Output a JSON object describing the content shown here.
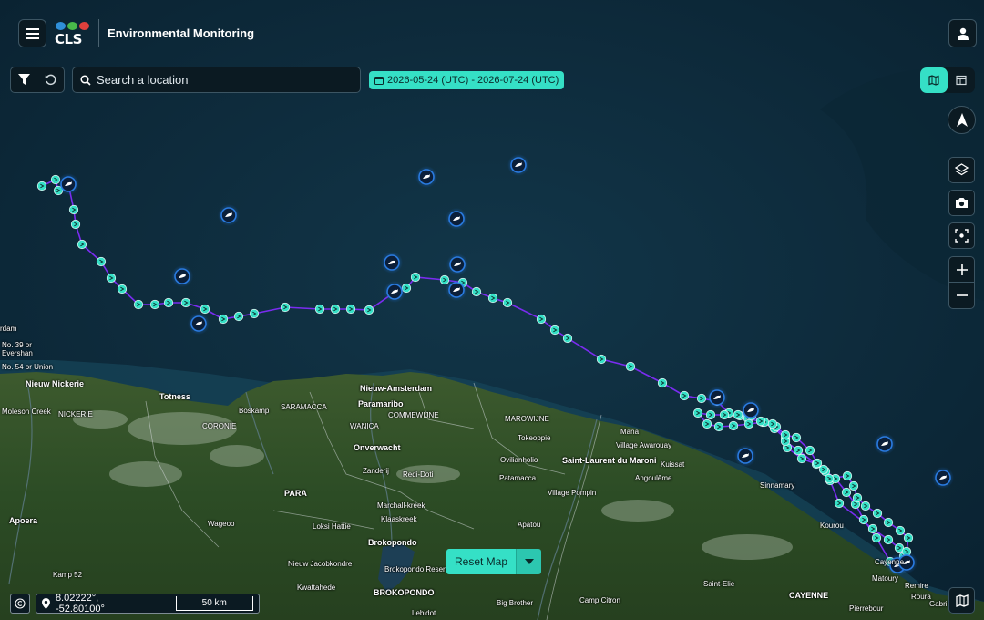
{
  "header": {
    "logo_text": "CLS",
    "title": "Environmental Monitoring",
    "menu_icon": "hamburger-icon",
    "user_icon": "user-icon",
    "logo_colors": [
      "#2f8fd8",
      "#48b84a",
      "#e0403c"
    ]
  },
  "toolbar": {
    "search_placeholder": "Search a location",
    "date_range": "2026-05-24 (UTC) - 2026-07-24 (UTC)"
  },
  "bottom": {
    "reset_label": "Reset Map",
    "coordinates": "8.02222°, -52.80100°",
    "scale_label": "50 km"
  },
  "colors": {
    "accent": "#35e0c6",
    "track": "#7a2cf0",
    "panel": "#0b1a22"
  },
  "map_labels": [
    {
      "text": "rdam"
    },
    {
      "text": "No. 39 or"
    },
    {
      "text": "Evershan"
    },
    {
      "text": "No. 54 or Union"
    },
    {
      "text": "Nieuw Nickerie"
    },
    {
      "text": "Moleson Creek"
    },
    {
      "text": "NICKERIE"
    },
    {
      "text": "Totness"
    },
    {
      "text": "CORONIE"
    },
    {
      "text": "Boskamp"
    },
    {
      "text": "SARAMACCA"
    },
    {
      "text": "Nieuw-Amsterdam"
    },
    {
      "text": "Paramaribo"
    },
    {
      "text": "COMMEWIJNE"
    },
    {
      "text": "WANICA"
    },
    {
      "text": "Onverwacht"
    },
    {
      "text": "MAROWIJNE"
    },
    {
      "text": "Mana"
    },
    {
      "text": "Village Awarouay"
    },
    {
      "text": "Tokeoppie"
    },
    {
      "text": "Ovilianholio"
    },
    {
      "text": "Saint-Laurent du Maroni"
    },
    {
      "text": "Patamacca"
    },
    {
      "text": "Zanderij"
    },
    {
      "text": "Redi-Doti"
    },
    {
      "text": "Kuissat"
    },
    {
      "text": "Sinnamary"
    },
    {
      "text": "Angoulême"
    },
    {
      "text": "Village Pompin"
    },
    {
      "text": "PARA"
    },
    {
      "text": "Marchall-kreek"
    },
    {
      "text": "Klaaskreek"
    },
    {
      "text": "Apoera"
    },
    {
      "text": "Wageoo"
    },
    {
      "text": "Loksi Hattie"
    },
    {
      "text": "Apatou"
    },
    {
      "text": "Brokopondo"
    },
    {
      "text": "Brokopondo Reservoir"
    },
    {
      "text": "Nieuw Jacobkondre"
    },
    {
      "text": "Kwattahede"
    },
    {
      "text": "BROKOPONDO"
    },
    {
      "text": "Kourou"
    },
    {
      "text": "Cayenne"
    },
    {
      "text": "Matoury"
    },
    {
      "text": "CAYENNE"
    },
    {
      "text": "Saint-Elie"
    },
    {
      "text": "Kamp 52"
    },
    {
      "text": "Big Brother"
    },
    {
      "text": "Camp Citron"
    },
    {
      "text": "Lebidot"
    },
    {
      "text": "Pierrebour"
    },
    {
      "text": "Remire"
    },
    {
      "text": "Roura"
    },
    {
      "text": "Gabriel"
    }
  ]
}
